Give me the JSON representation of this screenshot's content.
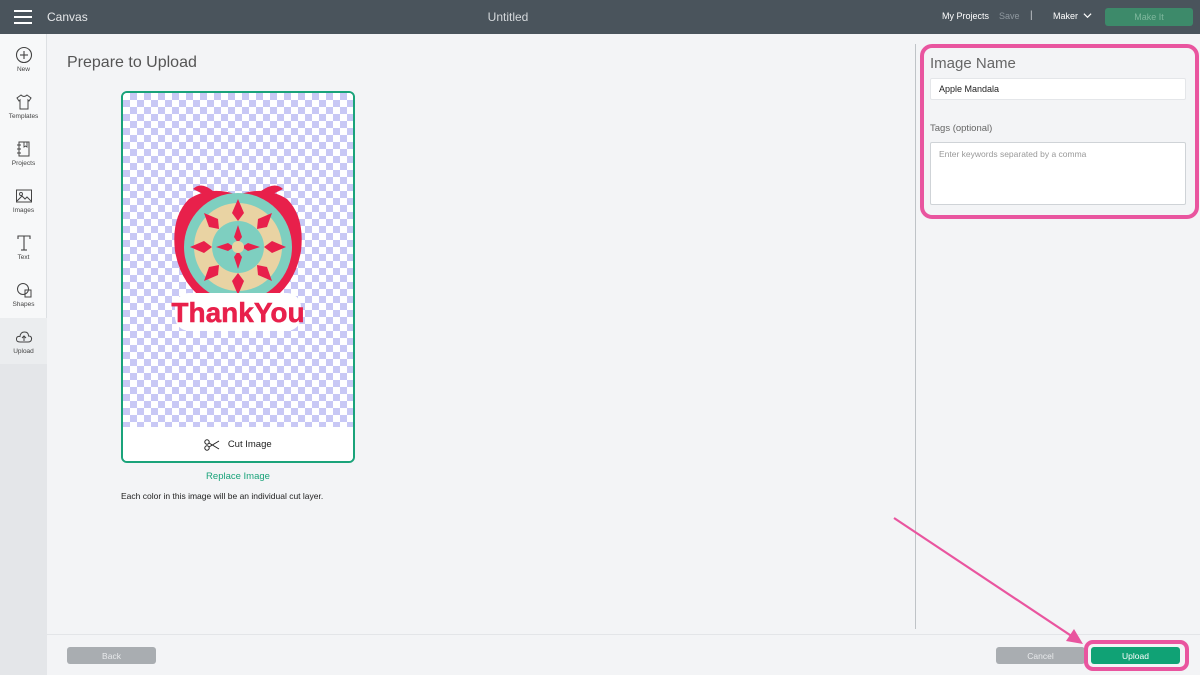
{
  "topbar": {
    "app_title": "Canvas",
    "doc_title": "Untitled",
    "my_projects": "My Projects",
    "save": "Save",
    "separator": "|",
    "machine": "Maker",
    "make_it": "Make It"
  },
  "sidebar": {
    "items": [
      {
        "label": "New",
        "icon": "plus-circle-icon"
      },
      {
        "label": "Templates",
        "icon": "tshirt-icon"
      },
      {
        "label": "Projects",
        "icon": "notebook-icon"
      },
      {
        "label": "Images",
        "icon": "image-icon"
      },
      {
        "label": "Text",
        "icon": "text-t-icon"
      },
      {
        "label": "Shapes",
        "icon": "shapes-icon"
      },
      {
        "label": "Upload",
        "icon": "cloud-upload-icon",
        "active": true
      }
    ]
  },
  "main": {
    "title": "Prepare to Upload",
    "cut_image_label": "Cut Image",
    "replace_image": "Replace Image",
    "layer_note": "Each color in this image will be an individual cut layer.",
    "artwork_text": "ThankYou"
  },
  "panel": {
    "image_name_title": "Image Name",
    "image_name_value": "Apple Mandala",
    "tags_label": "Tags (optional)",
    "tags_placeholder": "Enter keywords separated by a comma"
  },
  "footer": {
    "back": "Back",
    "cancel": "Cancel",
    "upload": "Upload"
  },
  "colors": {
    "accent": "#10a275",
    "highlight": "#e9559f",
    "topbar": "#4a545c"
  }
}
